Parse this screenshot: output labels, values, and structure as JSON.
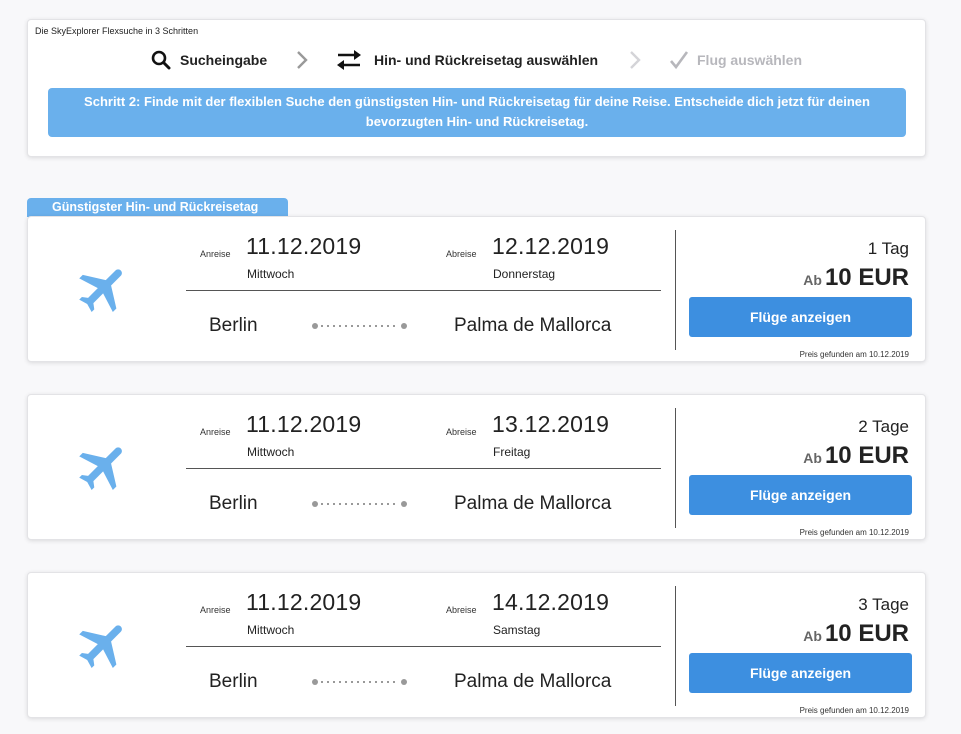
{
  "steps_card": {
    "title": "Die SkyExplorer Flexsuche in 3 Schritten",
    "steps": [
      {
        "label": "Sucheingabe",
        "icon": "search-icon",
        "state": "done"
      },
      {
        "label": "Hin- und Rückreisetag auswählen",
        "icon": "swap-arrows-icon",
        "state": "active"
      },
      {
        "label": "Flug auswählen",
        "icon": "checkmark-icon",
        "state": "disabled"
      }
    ],
    "hint": "Schritt 2: Finde mit der flexiblen Suche den günstigsten Hin- und Rückreisetag für deine Reise. Entscheide dich jetzt für deinen bevorzugten Hin- und Rückreisetag."
  },
  "best_tab_label": "Günstigster Hin- und Rückreisetag",
  "colors": {
    "accent": "#6ab0ec",
    "button": "#3d8fe0",
    "plane": "#6ab0ec",
    "disabled": "#b7b7bc"
  },
  "results": [
    {
      "anreise_label": "Anreise",
      "anreise_date": "11.12.2019",
      "anreise_weekday": "Mittwoch",
      "abreise_label": "Abreise",
      "abreise_date": "12.12.2019",
      "abreise_weekday": "Donnerstag",
      "origin": "Berlin",
      "destination": "Palma de Mallorca",
      "duration": "1 Tag",
      "price_prefix": "Ab",
      "price": "10 EUR",
      "button_label": "Flüge anzeigen",
      "found_note": "Preis gefunden am 10.12.2019"
    },
    {
      "anreise_label": "Anreise",
      "anreise_date": "11.12.2019",
      "anreise_weekday": "Mittwoch",
      "abreise_label": "Abreise",
      "abreise_date": "13.12.2019",
      "abreise_weekday": "Freitag",
      "origin": "Berlin",
      "destination": "Palma de Mallorca",
      "duration": "2 Tage",
      "price_prefix": "Ab",
      "price": "10 EUR",
      "button_label": "Flüge anzeigen",
      "found_note": "Preis gefunden am 10.12.2019"
    },
    {
      "anreise_label": "Anreise",
      "anreise_date": "11.12.2019",
      "anreise_weekday": "Mittwoch",
      "abreise_label": "Abreise",
      "abreise_date": "14.12.2019",
      "abreise_weekday": "Samstag",
      "origin": "Berlin",
      "destination": "Palma de Mallorca",
      "duration": "3 Tage",
      "price_prefix": "Ab",
      "price": "10 EUR",
      "button_label": "Flüge anzeigen",
      "found_note": "Preis gefunden am 10.12.2019"
    }
  ]
}
